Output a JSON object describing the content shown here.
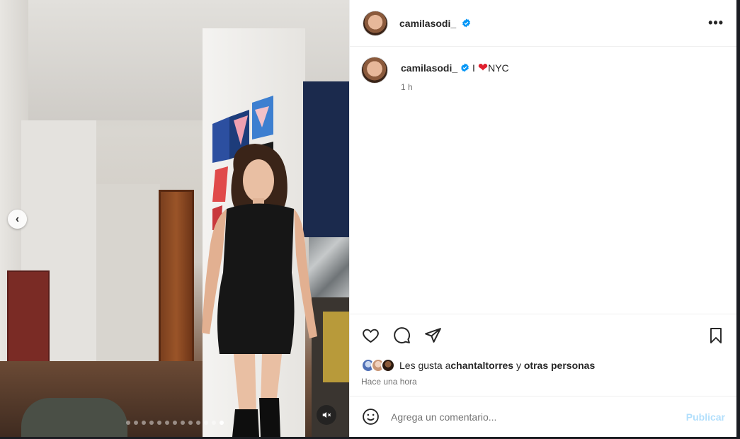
{
  "post": {
    "username": "camilasodi_",
    "verified": true,
    "more_label": "•••"
  },
  "caption": {
    "username": "camilasodi_",
    "prefix": "I ",
    "heart": "❤",
    "text": "NYC",
    "time": "1 h"
  },
  "likes": {
    "prefix": "Les gusta a ",
    "user": "chantaltorres",
    "middle": " y ",
    "others": "otras personas"
  },
  "posted_ago": "Hace una hora",
  "comment": {
    "placeholder": "Agrega un comentario...",
    "publish_label": "Publicar"
  },
  "media": {
    "slide_count": 13,
    "active_slide": 13,
    "prev_glyph": "‹"
  },
  "colors": {
    "verified": "#0095f6",
    "heart": "#ed4956",
    "publish_disabled": "#b2dffc"
  }
}
